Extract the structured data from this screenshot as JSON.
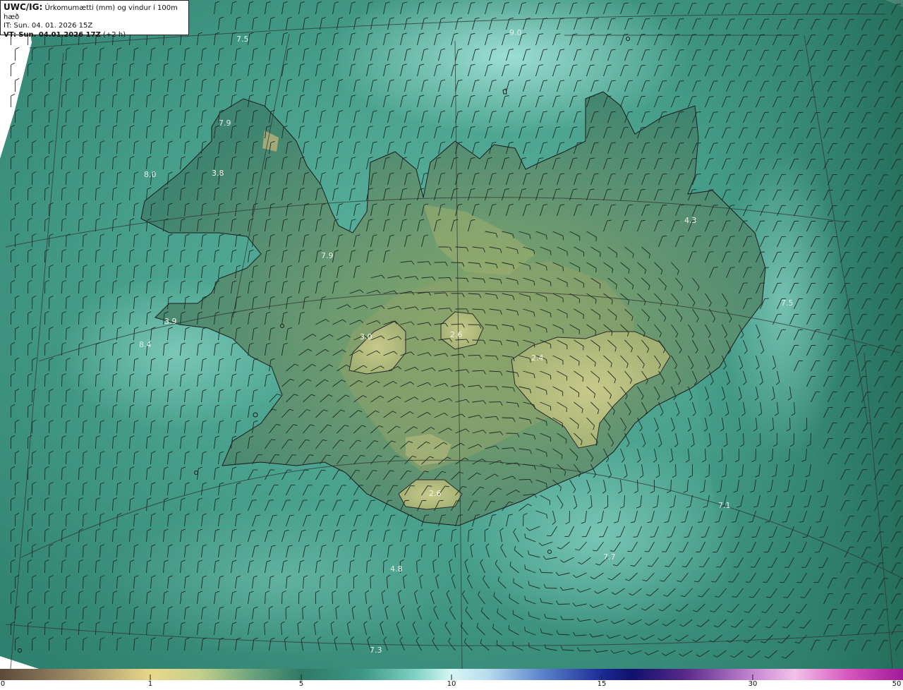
{
  "header": {
    "model": "UWC/IG:",
    "title": "Úrkomumætti (mm) og vindur í 100m hæð",
    "issue_time": "IT: Sun. 04. 01. 2026 15Z",
    "valid_prefix": "VT:",
    "valid_time": "Sun. 04.01.2026 17Z",
    "valid_offset": "(+2 h)"
  },
  "value_labels": [
    {
      "text": "7.5"
    },
    {
      "text": "9.0"
    },
    {
      "text": "7.9"
    },
    {
      "text": "8.0"
    },
    {
      "text": "3.8"
    },
    {
      "text": "7.9"
    },
    {
      "text": "3.9"
    },
    {
      "text": "8.4"
    },
    {
      "text": "3.0"
    },
    {
      "text": "2.6"
    },
    {
      "text": "2.4"
    },
    {
      "text": "2.6"
    },
    {
      "text": "4.3"
    },
    {
      "text": "7.5"
    },
    {
      "text": "7.1"
    },
    {
      "text": "7.7"
    },
    {
      "text": "4.8"
    },
    {
      "text": "7.3"
    }
  ],
  "colorbar": {
    "ticks": [
      "0",
      "1",
      "5",
      "10",
      "15",
      "30",
      "50"
    ],
    "colors": [
      "#5c4a3a",
      "#b9a67a",
      "#f1e58f",
      "#c9d78f",
      "#5fa57c",
      "#2d7a66",
      "#2f8d7a",
      "#6fc8bb",
      "#bff0ea",
      "#dff6f8",
      "#9ed0ea",
      "#4a78c6",
      "#1f2f9c",
      "#0b0b6a",
      "#5b2d8c",
      "#b96dc8",
      "#f0b6e8",
      "#d44fb8",
      "#a41498"
    ]
  },
  "icons": [
    "wind-barb-icon",
    "coastline",
    "terrain-shading"
  ]
}
